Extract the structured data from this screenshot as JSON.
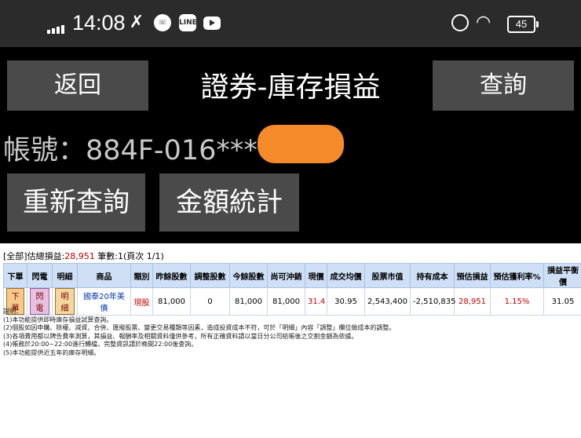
{
  "status_bar": {
    "time": "14:08",
    "battery": "45"
  },
  "header": {
    "back_label": "返回",
    "title": "證券-庫存損益",
    "query_label": "查詢",
    "account": "帳號：884F-016****",
    "requery_label": "重新查詢",
    "amount_stats_label": "金額統計"
  },
  "summary": {
    "prefix": "[全部]估總損益:",
    "total_pl": "28,951",
    "count_text": " 筆數:1(頁次 1/1)"
  },
  "table": {
    "headers": [
      "下單",
      "閃電",
      "明細",
      "商品",
      "類別",
      "昨餘股數",
      "調整股數",
      "今餘股數",
      "尚可沖銷",
      "現價",
      "成交均價",
      "股票市值",
      "持有成本",
      "預估損益",
      "預估獲利率%",
      "損益平衡價"
    ],
    "row": {
      "order_label": "下單",
      "flash_label": "閃電",
      "detail_label": "明細",
      "product": "國泰20年美債",
      "category": "現股",
      "prev_shares": "81,000",
      "adjust_shares": "0",
      "today_shares": "81,000",
      "offsettable": "81,000",
      "price": "31.4",
      "avg_price": "30.95",
      "market_value": "2,543,400",
      "cost": "-2,510,835",
      "est_pl": "28,951",
      "est_rate": "1.15%",
      "breakeven": "31.05"
    }
  },
  "notes": {
    "title": "說明：",
    "lines": [
      "(1)本功能提供即時庫存損益試算查詢。",
      "(2)個股如因申購、除權、減資、合併、匯撥股票、變更交易種類等因素，造成投資成本不符，可於「明細」內容「調整」欄位做成本的調整。",
      "(3)各項費用都以牌告費率測算，其損益、報酬率及相關資料僅供參考，所有正確資料請以當日分公司結帳後之交割金額為依據。",
      "(4)帳務於20:00~22:00進行轉檔，完整資訊請於晚間22:00後查詢。",
      "(5)本功能提供近五年的庫存明細。"
    ]
  },
  "colors": {
    "header_bg": "#000000",
    "button_bg": "#4a4a4a",
    "mask": "#f58a2a",
    "table_header_bg": "#cfe0f6",
    "profit_red": "#c00000"
  }
}
